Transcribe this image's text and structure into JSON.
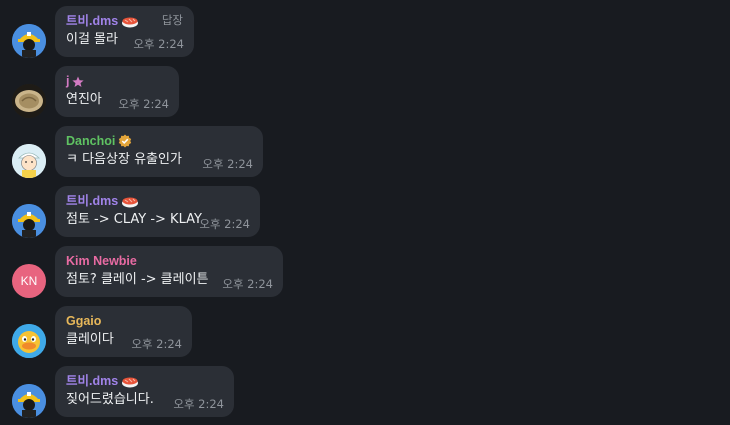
{
  "colors": {
    "background": "#181b20",
    "bubble": "#2b2f36",
    "name_tv": "#a083e8",
    "name_j": "#d37bc3",
    "name_danchoi": "#5fc262",
    "name_kim": "#e86ba3",
    "name_ggaio": "#e8b85a",
    "time": "#8f949b"
  },
  "messages": [
    {
      "name": "트비.dms",
      "text": "이걸 몰라",
      "time": "오후 2:24",
      "reply": "답장"
    },
    {
      "name": "j",
      "text": "연진아",
      "time": "오후 2:24"
    },
    {
      "name": "Danchoi",
      "text": "ㅋ 다음상장 유출인가",
      "time": "오후 2:24"
    },
    {
      "name": "트비.dms",
      "text": "점토 -> CLAY -> KLAY",
      "time": "오후 2:24"
    },
    {
      "name": "Kim Newbie",
      "avatar_initials": "KN",
      "text": "점토? 클레이 -> 클레이튼",
      "time": "오후 2:24"
    },
    {
      "name": "Ggaio",
      "text": "클레이다",
      "time": "오후 2:24"
    },
    {
      "name": "트비.dms",
      "text": "짖어드렸습니다.",
      "time": "오후 2:24"
    }
  ]
}
